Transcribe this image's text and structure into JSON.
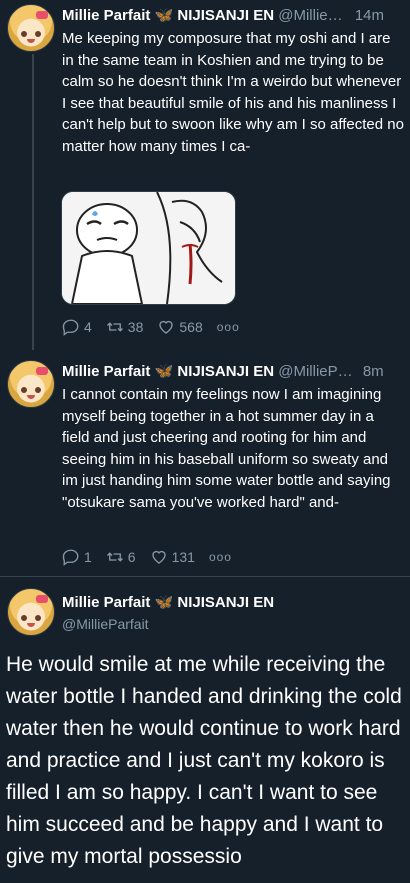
{
  "tweets": [
    {
      "name": "Millie Parfait 🦋 NIJISANJI EN",
      "handle": "@Millie…",
      "time": "14m",
      "text": "Me keeping my composure that my oshi and I are in the same team in Koshien and me trying to be calm so he doesn't think I'm a weirdo but whenever I see that beautiful smile of his and his manliness I can't help but to swoon like why am I so affected no matter how many times I ca-",
      "replies": "4",
      "retweets": "38",
      "likes": "568"
    },
    {
      "name": "Millie Parfait 🦋 NIJISANJI EN",
      "handle": "@MillieP…",
      "time": "8m",
      "text": "I cannot contain my feelings now I am imagining myself being together in a hot summer day in a field and just cheering and rooting for him and seeing him in his baseball uniform so sweaty and im just handing him some water bottle and saying \"otsukare sama you've worked hard\" and-",
      "replies": "1",
      "retweets": "6",
      "likes": "131"
    }
  ],
  "main_tweet": {
    "name": "Millie Parfait 🦋 NIJISANJI EN",
    "handle": "@MillieParfait",
    "text": "He would smile at me while receiving the water bottle I handed and drinking the cold water then he would continue to work hard and practice and I just can't my kokoro is filled I am so happy. I can't I want to see him succeed and be happy and I want to give my mortal possessio"
  },
  "more_label": "ooo",
  "icons": {
    "reply": "reply-icon",
    "retweet": "retweet-icon",
    "like": "heart-icon",
    "more": "more-icon"
  }
}
